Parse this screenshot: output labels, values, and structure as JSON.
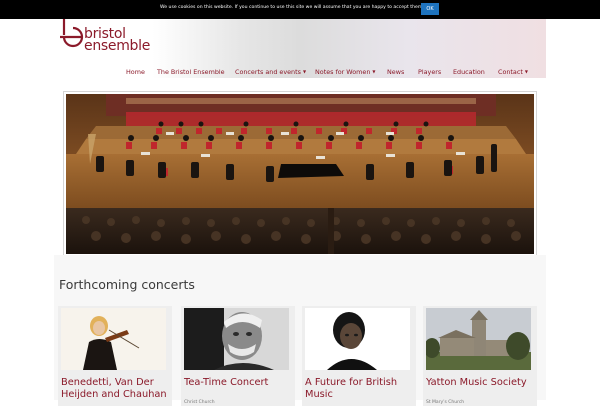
{
  "cookie_bar": {
    "text": "We use cookies on this website. If you continue to use this site we will assume that you are happy to accept them.",
    "ok_label": "OK"
  },
  "logo": {
    "line1": "bristol",
    "line2": "ensemble",
    "color": "#8b1a2a"
  },
  "nav": {
    "items": [
      {
        "label": "Home",
        "dropdown": false
      },
      {
        "label": "The Bristol Ensemble",
        "dropdown": false
      },
      {
        "label": "Concerts and events",
        "dropdown": true
      },
      {
        "label": "Notes for Women",
        "dropdown": true
      },
      {
        "label": "News",
        "dropdown": false
      },
      {
        "label": "Players",
        "dropdown": false
      },
      {
        "label": "Education",
        "dropdown": false
      },
      {
        "label": "Contact",
        "dropdown": true
      }
    ],
    "caret": "▼"
  },
  "hero": {
    "image": "orchestra-on-stage-photo"
  },
  "concerts": {
    "title": "Forthcoming concerts",
    "cards": [
      {
        "title": "Benedetti, Van Der Heijden and Chauhan",
        "venue": "",
        "image": "violinist-photo"
      },
      {
        "title": "Tea-Time Concert",
        "venue": "Christ Church",
        "image": "composer-portrait-photo"
      },
      {
        "title": "A Future for British Music",
        "venue": "",
        "image": "singer-portrait-photo"
      },
      {
        "title": "Yatton Music Society",
        "venue": "St Mary's Church",
        "image": "church-photo"
      }
    ]
  },
  "colors": {
    "brand": "#8b1a2a",
    "cookie_button": "#1e73be"
  }
}
